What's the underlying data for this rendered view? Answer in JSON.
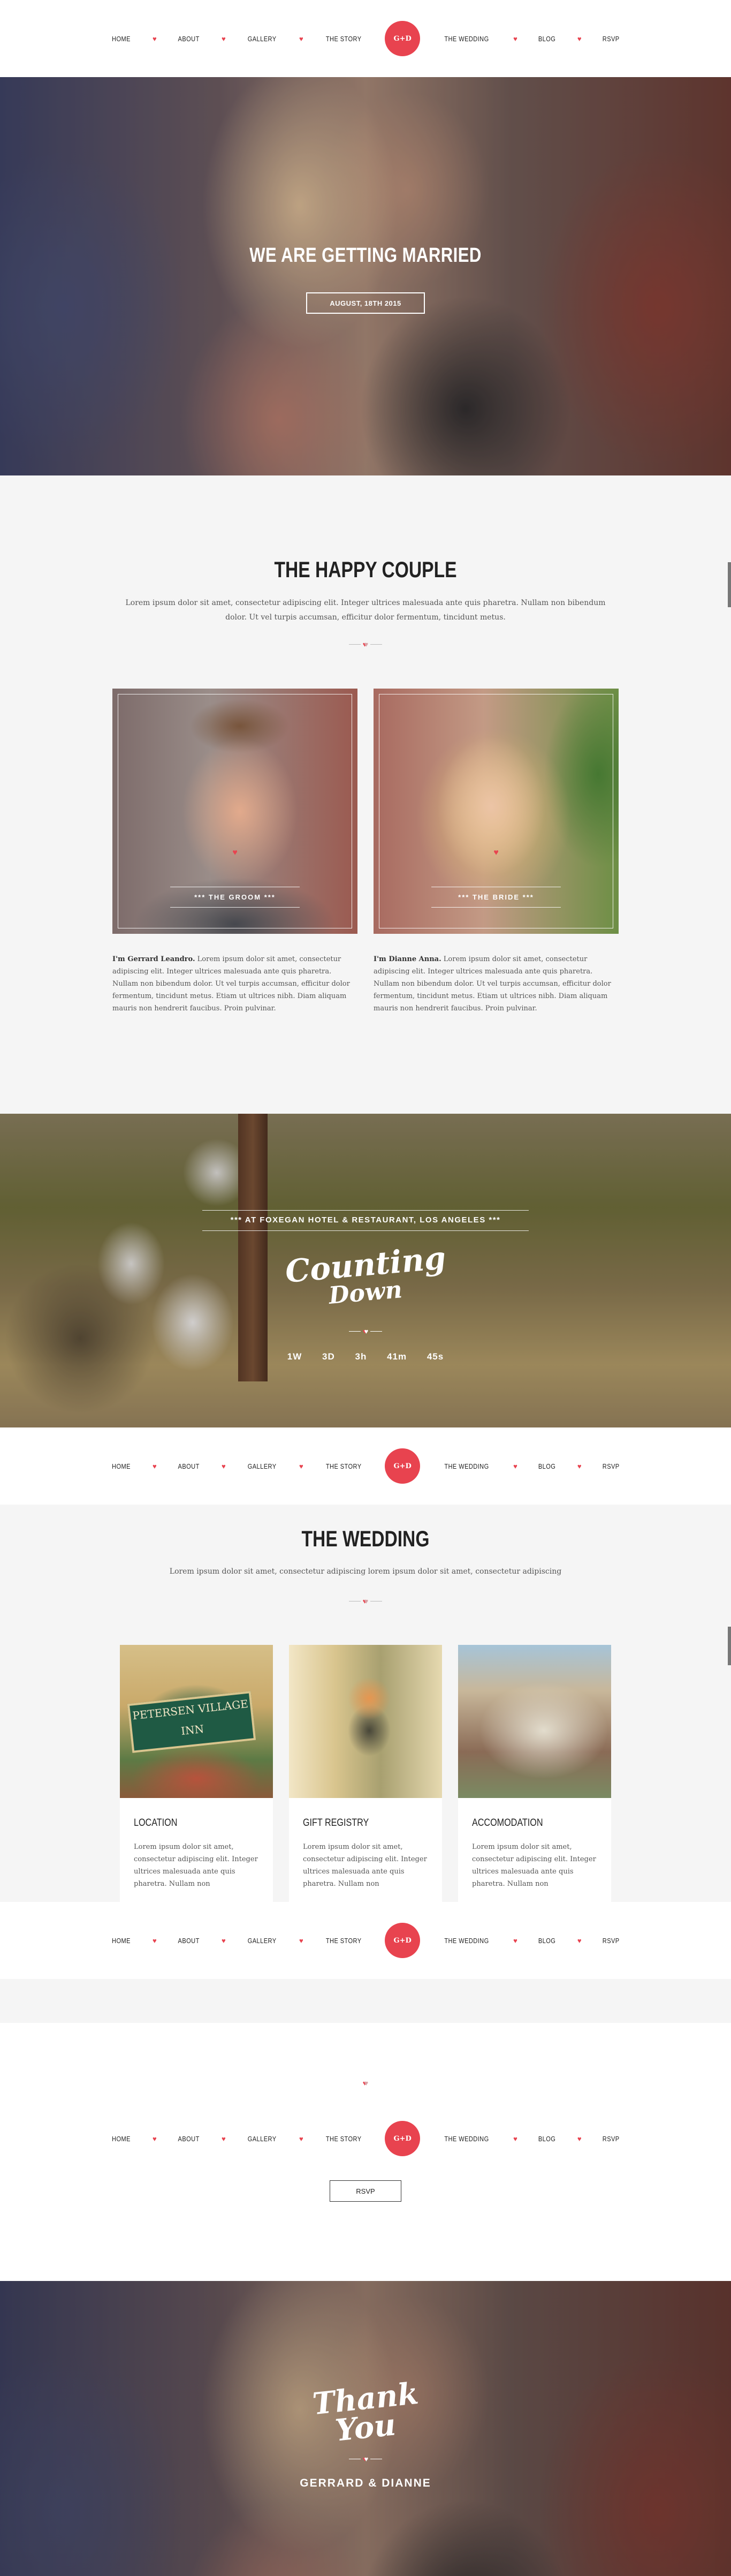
{
  "nav": {
    "logo": "G+D",
    "left_items": [
      "HOME",
      "ABOUT",
      "GALLERY",
      "THE STORY"
    ],
    "right_items": [
      "THE WEDDING",
      "BLOG",
      "RSVP"
    ]
  },
  "hero": {
    "title": "WE ARE GETTING MARRIED",
    "date": "AUGUST, 18TH 2015"
  },
  "couple": {
    "title": "THE HAPPY COUPLE",
    "intro_line1": "Lorem ipsum dolor sit amet, consectetur adipiscing elit. Integer ultrices malesuada ante quis pharetra. Nullam non bibendum",
    "intro_line2": "dolor. Ut vel turpis accumsan, efficitur dolor fermentum, tincidunt metus.",
    "groom": {
      "label": "*** THE GROOM ***",
      "name": "I'm Gerrard Leandro.",
      "bio": "Lorem ipsum dolor sit amet, consectetur adipiscing elit. Integer ultrices malesuada ante quis pharetra. Nullam non bibendum dolor. Ut vel turpis accumsan, efficitur dolor fermentum, tincidunt metus. Etiam ut ultrices nibh. Diam aliquam mauris non hendrerit faucibus. Proin pulvinar."
    },
    "bride": {
      "label": "*** THE BRIDE ***",
      "name": "I'm Dianne Anna.",
      "bio": "Lorem ipsum dolor sit amet, consectetur adipiscing elit. Integer ultrices malesuada ante quis pharetra. Nullam non bibendum dolor. Ut vel turpis accumsan, efficitur dolor fermentum, tincidunt metus. Etiam ut ultrices nibh. Diam aliquam mauris non hendrerit faucibus. Proin pulvinar."
    }
  },
  "countdown": {
    "venue": "*** AT FOXEGAN HOTEL & RESTAURANT, LOS ANGELES ***",
    "script_line1": "Counting",
    "script_line2": "Down",
    "timer": [
      "1W",
      "3D",
      "3h",
      "41m",
      "45s"
    ]
  },
  "wedding": {
    "title": "THE WEDDING",
    "intro": "Lorem ipsum dolor sit amet, consectetur adipiscing lorem ipsum dolor sit amet, consectetur adipiscing",
    "sign_text": "PETERSEN VILLAGE INN",
    "cards": [
      {
        "title": "LOCATION",
        "text": "Lorem ipsum dolor sit amet, consectetur adipiscing elit. Integer ultrices malesuada ante quis pharetra. Nullam non"
      },
      {
        "title": "GIFT REGISTRY",
        "text": "Lorem ipsum dolor sit amet, consectetur adipiscing elit. Integer ultrices malesuada ante quis pharetra. Nullam non"
      },
      {
        "title": "ACCOMODATION",
        "text": "Lorem ipsum dolor sit amet, consectetur adipiscing elit. Integer ultrices malesuada ante quis pharetra. Nullam non"
      }
    ]
  },
  "rsvp": {
    "button": "RSVP"
  },
  "footer": {
    "script_line1": "Thank",
    "script_line2": "You",
    "names": "GERRARD & DIANNE"
  },
  "colors": {
    "accent": "#e8434f",
    "grey_bg": "#f5f5f5"
  }
}
